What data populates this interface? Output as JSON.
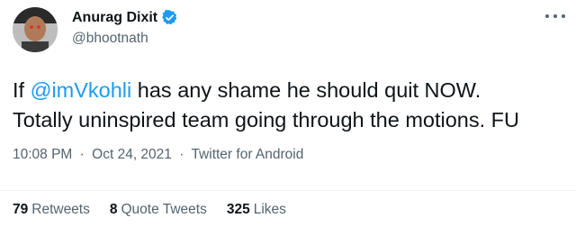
{
  "author": {
    "name": "Anurag Dixit",
    "handle": "@bhootnath",
    "verified_color": "#1d9bf0"
  },
  "tweet": {
    "line1_before": "If ",
    "mention": "@imVkohli",
    "line1_after": " has any shame he should quit NOW.",
    "line2": "Totally uninspired team going through the motions. FU"
  },
  "meta": {
    "time": "10:08 PM",
    "separator": "·",
    "date": "Oct 24, 2021",
    "source": "Twitter for Android"
  },
  "stats": {
    "retweets_count": "79",
    "retweets_label": "Retweets",
    "quotes_count": "8",
    "quotes_label": "Quote Tweets",
    "likes_count": "325",
    "likes_label": "Likes"
  },
  "colors": {
    "text": "#0f1419",
    "secondary": "#536471",
    "accent": "#1d9bf0"
  },
  "icons": {
    "verified": "verified-badge-icon",
    "more": "more-icon"
  }
}
